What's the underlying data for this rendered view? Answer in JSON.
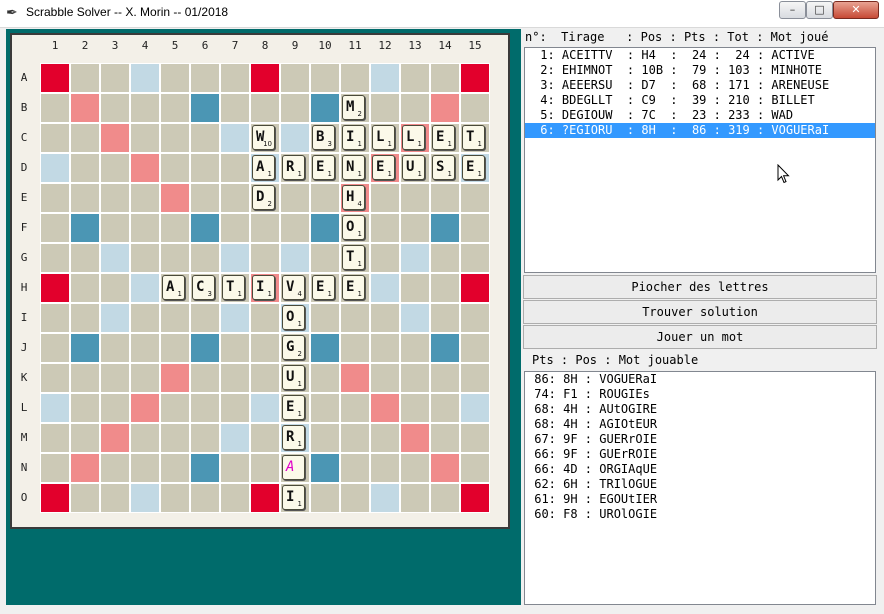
{
  "window": {
    "title": "Scrabble Solver -- X. Morin -- 01/2018",
    "icon": "feather-icon"
  },
  "board": {
    "col_labels": [
      "1",
      "2",
      "3",
      "4",
      "5",
      "6",
      "7",
      "8",
      "9",
      "10",
      "11",
      "12",
      "13",
      "14",
      "15"
    ],
    "row_labels": [
      "A",
      "B",
      "C",
      "D",
      "E",
      "F",
      "G",
      "H",
      "I",
      "J",
      "K",
      "L",
      "M",
      "N",
      "O"
    ],
    "bonus_map": [
      "T..d...T...d..T",
      ".D...t...t...D.",
      "..D...d.d...D..",
      "d..D...d...D..d",
      "....D.....D....",
      ".t...t...t...t.",
      "..d...d.d...d..",
      "T..d...D...d..T",
      "..d...d.d...d..",
      ".t...t...t...t.",
      "....D.....D....",
      "d..D...d...D..d",
      "..D...d.d...D..",
      ".D...t...t...D.",
      "T..d...T...d..T"
    ],
    "colors": {
      "triple_word": "#e2002c",
      "double_word": "#f08b8b",
      "triple_letter": "#4b96b4",
      "double_letter": "#c2d9e4",
      "normal": "#ccc9b6",
      "blank_letter": "#e000c8"
    },
    "tiles": [
      {
        "row": 1,
        "col": 10,
        "letter": "M",
        "pts": "2"
      },
      {
        "row": 2,
        "col": 7,
        "letter": "W",
        "pts": "10"
      },
      {
        "row": 2,
        "col": 9,
        "letter": "B",
        "pts": "3"
      },
      {
        "row": 2,
        "col": 10,
        "letter": "I",
        "pts": "1"
      },
      {
        "row": 2,
        "col": 11,
        "letter": "L",
        "pts": "1"
      },
      {
        "row": 2,
        "col": 12,
        "letter": "L",
        "pts": "1"
      },
      {
        "row": 2,
        "col": 13,
        "letter": "E",
        "pts": "1"
      },
      {
        "row": 2,
        "col": 14,
        "letter": "T",
        "pts": "1"
      },
      {
        "row": 3,
        "col": 7,
        "letter": "A",
        "pts": "1"
      },
      {
        "row": 3,
        "col": 8,
        "letter": "R",
        "pts": "1"
      },
      {
        "row": 3,
        "col": 9,
        "letter": "E",
        "pts": "1"
      },
      {
        "row": 3,
        "col": 10,
        "letter": "N",
        "pts": "1"
      },
      {
        "row": 3,
        "col": 11,
        "letter": "E",
        "pts": "1"
      },
      {
        "row": 3,
        "col": 12,
        "letter": "U",
        "pts": "1"
      },
      {
        "row": 3,
        "col": 13,
        "letter": "S",
        "pts": "1"
      },
      {
        "row": 3,
        "col": 14,
        "letter": "E",
        "pts": "1"
      },
      {
        "row": 4,
        "col": 7,
        "letter": "D",
        "pts": "2"
      },
      {
        "row": 4,
        "col": 10,
        "letter": "H",
        "pts": "4"
      },
      {
        "row": 5,
        "col": 10,
        "letter": "O",
        "pts": "1"
      },
      {
        "row": 6,
        "col": 10,
        "letter": "T",
        "pts": "1"
      },
      {
        "row": 7,
        "col": 4,
        "letter": "A",
        "pts": "1"
      },
      {
        "row": 7,
        "col": 5,
        "letter": "C",
        "pts": "3"
      },
      {
        "row": 7,
        "col": 6,
        "letter": "T",
        "pts": "1"
      },
      {
        "row": 7,
        "col": 7,
        "letter": "I",
        "pts": "1"
      },
      {
        "row": 7,
        "col": 8,
        "letter": "V",
        "pts": "4"
      },
      {
        "row": 7,
        "col": 9,
        "letter": "E",
        "pts": "1"
      },
      {
        "row": 7,
        "col": 10,
        "letter": "E",
        "pts": "1"
      },
      {
        "row": 8,
        "col": 8,
        "letter": "O",
        "pts": "1"
      },
      {
        "row": 9,
        "col": 8,
        "letter": "G",
        "pts": "2"
      },
      {
        "row": 10,
        "col": 8,
        "letter": "U",
        "pts": "1"
      },
      {
        "row": 11,
        "col": 8,
        "letter": "E",
        "pts": "1"
      },
      {
        "row": 12,
        "col": 8,
        "letter": "R",
        "pts": "1"
      },
      {
        "row": 13,
        "col": 8,
        "letter": "A",
        "pts": "",
        "blank": true
      },
      {
        "row": 14,
        "col": 8,
        "letter": "I",
        "pts": "1"
      }
    ]
  },
  "history": {
    "header": "n°:  Tirage   : Pos : Pts : Tot : Mot joué",
    "rows": [
      " 1: ACEITTV  : H4  :  24 :  24 : ACTIVE",
      " 2: EHIMNOT  : 10B :  79 : 103 : MINHOTE",
      " 3: AEEERSU  : D7  :  68 : 171 : ARENEUSE",
      " 4: BDEGLLT  : C9  :  39 : 210 : BILLET",
      " 5: DEGIOUW  : 7C  :  23 : 233 : WAD",
      " 6: ?EGIORU  : 8H  :  86 : 319 : VOGUERaI"
    ],
    "selected_index": 5
  },
  "buttons": {
    "draw": "Piocher des lettres",
    "find": "Trouver solution",
    "play": "Jouer un mot"
  },
  "solutions": {
    "header": "Pts : Pos : Mot jouable",
    "rows": [
      " 86: 8H : VOGUERaI",
      " 74: F1 : ROUGIEs",
      " 68: 4H : AUtOGIRE",
      " 68: 4H : AGIOtEUR",
      " 67: 9F : GUERrOIE",
      " 66: 9F : GUErROIE",
      " 66: 4D : ORGIAqUE",
      " 62: 6H : TRIlOGUE",
      " 61: 9H : EGOUtIER",
      " 60: F8 : UROlOGIE"
    ]
  }
}
